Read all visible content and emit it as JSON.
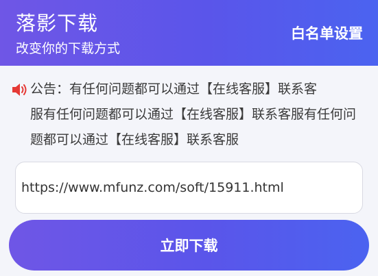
{
  "header": {
    "title": "落影下载",
    "subtitle": "改变你的下载方式",
    "whitelist_label": "白名单设置"
  },
  "notice": {
    "icon": "speaker-icon",
    "icon_color": "#e53935",
    "line1": "公告：有任何问题都可以通过【在线客服】联系客",
    "rest": "服有任何问题都可以通过【在线客服】联系客服有任何问题都可以通过【在线客服】联系客服"
  },
  "url_input": {
    "value": "https://www.mfunz.com/soft/15911.html"
  },
  "download_button": {
    "label": "立即下载"
  },
  "colors": {
    "accent_start": "#6f56e6",
    "accent_end": "#4b63f0",
    "background": "#f4f5fa"
  }
}
